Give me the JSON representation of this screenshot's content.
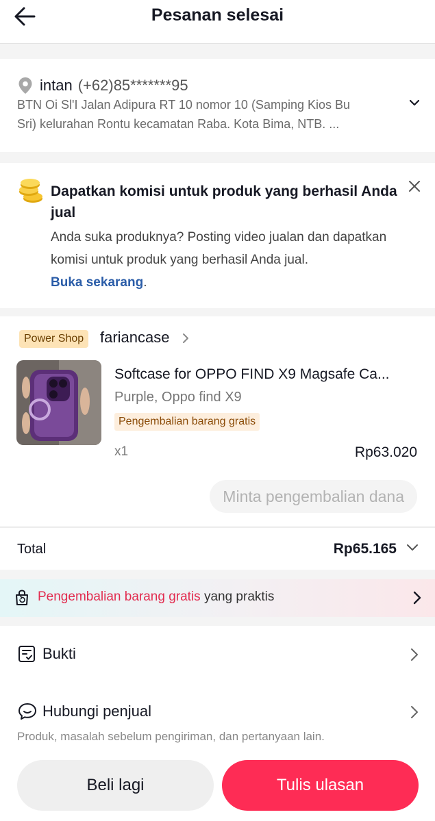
{
  "header": {
    "title": "Pesanan selesai",
    "back_icon": "arrow-left-icon"
  },
  "address": {
    "name": "intan",
    "phone": "(+62)85*******95",
    "line1": "BTN Oi Sl'I Jalan Adipura RT 10 nomor 10 (Samping Kios Bu",
    "line2": "Sri) kelurahan Rontu kecamatan Raba. Kota Bima, NTB. ..."
  },
  "promo": {
    "title": "Dapatkan komisi untuk produk yang berhasil Anda jual",
    "body": "Anda suka produknya? Posting video jualan dan dapatkan komisi untuk produk yang berhasil Anda jual.",
    "link": "Buka sekarang",
    "link_suffix": "."
  },
  "order": {
    "badge": "Power Shop",
    "shop_name": "fariancase",
    "product_name": "Softcase for OPPO FIND X9 Magsafe Ca...",
    "variant": "Purple, Oppo find X9",
    "tag": "Pengembalian barang gratis",
    "quantity": "x1",
    "price": "Rp63.020",
    "refund_button": "Minta pengembalian dana"
  },
  "total": {
    "label": "Total",
    "value": "Rp65.165"
  },
  "free_return": {
    "highlight": "Pengembalian barang gratis",
    "rest": " yang praktis"
  },
  "rows": {
    "proof": "Bukti",
    "contact": "Hubungi penjual",
    "contact_sub": "Produk, masalah sebelum pengiriman, dan pertanyaan lain."
  },
  "footer": {
    "buy_again": "Beli lagi",
    "review": "Tulis ulasan"
  },
  "colors": {
    "accent": "#fe2c55",
    "link": "#2b5da8",
    "badge_bg": "#fde3b6",
    "tag_bg": "#fdeedd"
  }
}
